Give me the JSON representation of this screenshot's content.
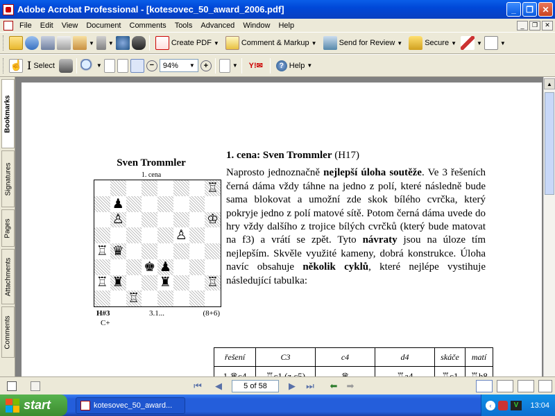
{
  "window": {
    "title": "Adobe Acrobat Professional - [kotesovec_50_award_2006.pdf]",
    "controls": [
      "_",
      "❐",
      "✕"
    ]
  },
  "menu": {
    "items": [
      "File",
      "Edit",
      "View",
      "Document",
      "Comments",
      "Tools",
      "Advanced",
      "Window",
      "Help"
    ],
    "doc_controls": [
      "_",
      "❐",
      "✕"
    ]
  },
  "toolbar1": {
    "create_pdf": "Create PDF",
    "comment_markup": "Comment & Markup",
    "send_review": "Send for Review",
    "secure": "Secure"
  },
  "toolbar2": {
    "select": "Select",
    "zoom_value": "94%",
    "help": "Help"
  },
  "sidetabs": {
    "bookmarks": "Bookmarks",
    "signatures": "Signatures",
    "pages": "Pages",
    "attachments": "Attachments",
    "comments": "Comments"
  },
  "problem": {
    "author": "Sven Trommler",
    "award": "1. cena",
    "stipulation": "H#3",
    "solutions": "3.1...",
    "count": "(8+6)",
    "cplus": "C+",
    "board": [
      [
        "",
        "",
        "",
        "",
        "",
        "",
        "",
        "♖"
      ],
      [
        "",
        "♟",
        "",
        "",
        "",
        "",
        "",
        ""
      ],
      [
        "",
        "♙",
        "",
        "",
        "",
        "",
        "",
        "♔"
      ],
      [
        "",
        "",
        "",
        "",
        "",
        "♙",
        "",
        ""
      ],
      [
        "♖",
        "♛",
        "",
        "",
        "",
        "",
        "",
        ""
      ],
      [
        "",
        "",
        "",
        "♚",
        "♟",
        "",
        "",
        ""
      ],
      [
        "♖",
        "♜",
        "",
        "",
        "♜",
        "",
        "",
        "♖"
      ],
      [
        "",
        "",
        "♖",
        "",
        "",
        "",
        "",
        ""
      ]
    ]
  },
  "article": {
    "heading_bold": "1. cena: Sven Trommler",
    "heading_rest": " (H17)",
    "p1": "Naprosto jednoznačně ",
    "p1b": "nejlepší úloha soutěže",
    "p2": ". Ve 3 řešeních černá dáma vždy táhne na jedno z polí, které následně bude sama blokovat a umožní zde skok bílého cvrčka, který pokryje jedno z polí matové sítě. Potom černá dáma uvede do hry vždy dalšího z trojice bílých cvrčků (který bude matovat na f3) a vrátí se zpět. Tyto ",
    "p2b": "návraty",
    "p3": " jsou na úloze tím nejlepším. Skvěle využité kameny, dobrá konstrukce. Úloha navíc obsahuje ",
    "p3b": "několik cyklů",
    "p4": ", které nejlépe vystihuje následující tabulka:"
  },
  "table": {
    "headers": [
      "řešení",
      "C3",
      "c4",
      "d4",
      "skáče",
      "matí"
    ],
    "row1": [
      "1.♛c4",
      "♖c1 (z c5)",
      "♛",
      "♖a4",
      "♖c1",
      "♖h8"
    ]
  },
  "nav": {
    "page": "5 of 58"
  },
  "taskbar": {
    "start": "start",
    "task": "kotesovec_50_award...",
    "clock": "13:04"
  }
}
